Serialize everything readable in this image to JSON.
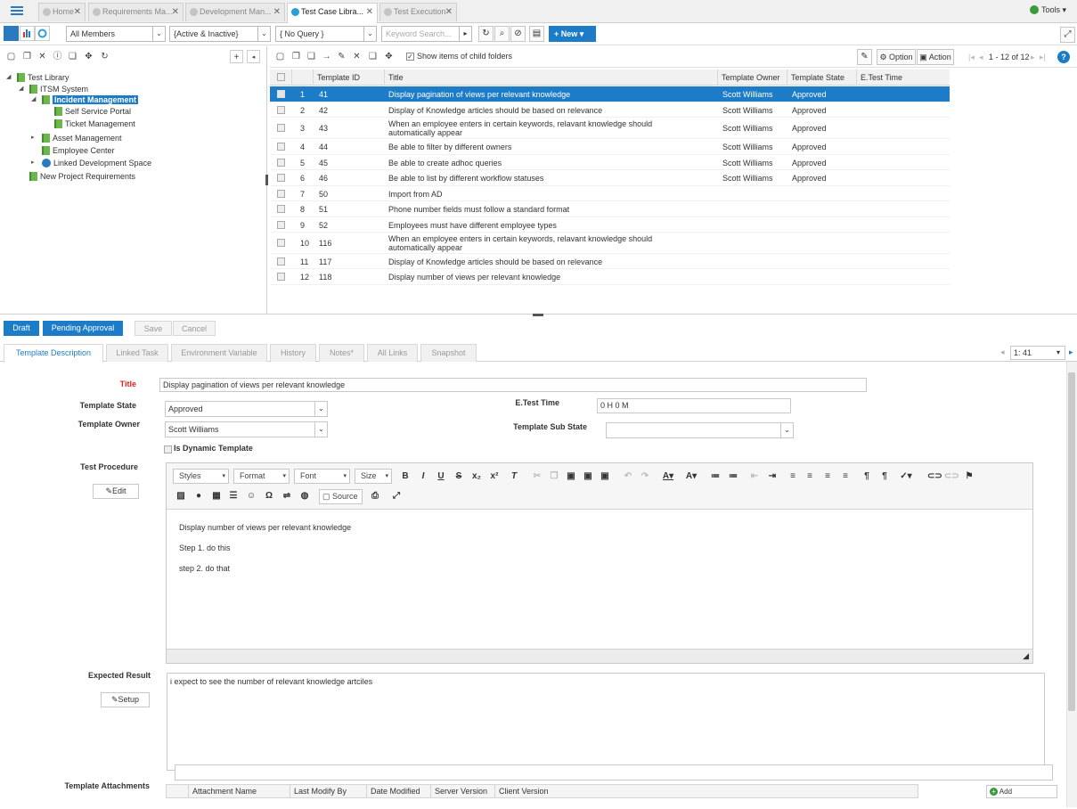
{
  "top_tabs": [
    {
      "label": "Home",
      "active": false
    },
    {
      "label": "Requirements Ma...",
      "active": false
    },
    {
      "label": "Development Man...",
      "active": false
    },
    {
      "label": "Test Case Libra...",
      "active": true
    },
    {
      "label": "Test Execution",
      "active": false
    }
  ],
  "tools_label": "Tools",
  "filters": {
    "members": "All Members",
    "status": "{Active & Inactive}",
    "query": "{ No Query }",
    "keyword_placeholder": "Keyword Search...",
    "new_label": "New"
  },
  "tree": {
    "root": "Test Library",
    "project": "ITSM System",
    "selected": "Incident Management",
    "children": [
      "Self Service Portal",
      "Ticket Management"
    ],
    "siblings": [
      "Asset Management",
      "Employee Center",
      "Linked Development Space"
    ],
    "other_project": "New Project Requirements"
  },
  "grid_toolbar": {
    "show_child_label": "Show items of child folders",
    "option_label": "Option",
    "action_label": "Action",
    "paging": "1 - 12 of 12"
  },
  "grid": {
    "columns": [
      "Template ID",
      "Title",
      "Template Owner",
      "Template State",
      "E.Test Time"
    ],
    "rows": [
      {
        "n": "1",
        "id": "41",
        "title": "Display pagination of views per relevant knowledge",
        "owner": "Scott Williams",
        "state": "Approved"
      },
      {
        "n": "2",
        "id": "42",
        "title": "Display of Knowledge articles should be based on relevance",
        "owner": "Scott Williams",
        "state": "Approved"
      },
      {
        "n": "3",
        "id": "43",
        "title": "When an employee enters in certain keywords, relavant knowledge should automatically appear",
        "owner": "Scott Williams",
        "state": "Approved"
      },
      {
        "n": "4",
        "id": "44",
        "title": "Be able to filter by different owners",
        "owner": "Scott Williams",
        "state": "Approved"
      },
      {
        "n": "5",
        "id": "45",
        "title": "Be able to create adhoc queries",
        "owner": "Scott Williams",
        "state": "Approved"
      },
      {
        "n": "6",
        "id": "46",
        "title": "Be able to list by different workflow statuses",
        "owner": "Scott Williams",
        "state": "Approved"
      },
      {
        "n": "7",
        "id": "50",
        "title": "Import from AD",
        "owner": "",
        "state": ""
      },
      {
        "n": "8",
        "id": "51",
        "title": "Phone number fields must follow a standard format",
        "owner": "",
        "state": ""
      },
      {
        "n": "9",
        "id": "52",
        "title": "Employees must have different employee types",
        "owner": "",
        "state": ""
      },
      {
        "n": "10",
        "id": "116",
        "title": "When an employee enters in certain keywords, relavant knowledge should automatically appear",
        "owner": "",
        "state": ""
      },
      {
        "n": "11",
        "id": "117",
        "title": "Display of Knowledge articles should be based on relevance",
        "owner": "",
        "state": ""
      },
      {
        "n": "12",
        "id": "118",
        "title": "Display number of views per relevant knowledge",
        "owner": "",
        "state": ""
      }
    ]
  },
  "workflow": {
    "draft": "Draft",
    "pending": "Pending Approval",
    "save": "Save",
    "cancel": "Cancel"
  },
  "detail_tabs": [
    "Template Description",
    "Linked Task",
    "Environment Variable",
    "History",
    "Notes*",
    "All Links",
    "Snapshot"
  ],
  "record_nav": "1: 41",
  "form": {
    "title_label": "Title",
    "title_value": "Display pagination of views per relevant knowledge",
    "state_label": "Template State",
    "state_value": "Approved",
    "owner_label": "Template Owner",
    "owner_value": "Scott Williams",
    "dynamic_label": "Is Dynamic Template",
    "etest_label": "E.Test Time",
    "etest_value": "0 H 0 M",
    "substate_label": "Template Sub State",
    "substate_value": "",
    "procedure_label": "Test Procedure",
    "edit_label": "Edit",
    "expected_label": "Expected Result",
    "setup_label": "Setup",
    "expected_value": "i expect to see the number of relevant knowledge artciles",
    "attachments_label": "Template Attachments",
    "add_label": "Add"
  },
  "attachment_columns": [
    "Attachment Name",
    "Last Modify By",
    "Date Modified",
    "Server Version",
    "Client Version"
  ],
  "editor": {
    "styles": "Styles",
    "format": "Format",
    "font": "Font",
    "size": "Size",
    "source": "Source",
    "lines": [
      "Display number of views per relevant knowledge",
      "Step 1. do this",
      "step 2. do that"
    ]
  },
  "colors": {
    "accent": "#1c7cc7",
    "selected_row": "#1c7cc7",
    "required_label": "#dd2222"
  }
}
